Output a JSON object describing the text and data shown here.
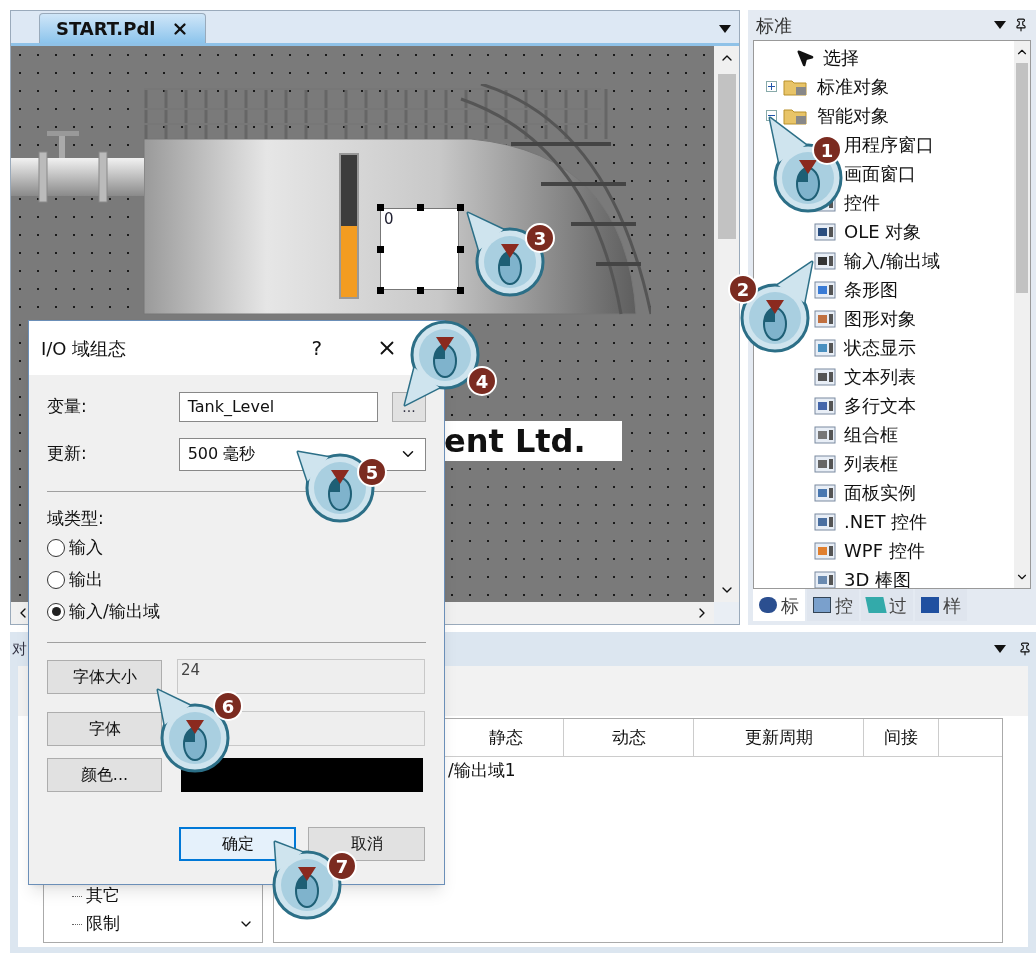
{
  "editor": {
    "tabs": [
      {
        "label": "START.Pdl",
        "selected": true
      }
    ],
    "canvas": {
      "bar_graph": {
        "level": 0.5
      },
      "io_field": {
        "value": "0"
      },
      "text_object": "ent Ltd."
    }
  },
  "toolbox": {
    "title": "标准",
    "tree": [
      {
        "label": "选择",
        "kind": "pointer"
      },
      {
        "label": "标准对象",
        "kind": "folder",
        "expanded": false
      },
      {
        "label": "智能对象",
        "kind": "folder",
        "expanded": true,
        "children": [
          {
            "label": "用程序窗口"
          },
          {
            "label": "画面窗口"
          },
          {
            "label": "控件"
          },
          {
            "label": "OLE 对象"
          },
          {
            "label": "输入/输出域"
          },
          {
            "label": "条形图"
          },
          {
            "label": "图形对象"
          },
          {
            "label": "状态显示"
          },
          {
            "label": "文本列表"
          },
          {
            "label": "多行文本"
          },
          {
            "label": "组合框"
          },
          {
            "label": "列表框"
          },
          {
            "label": "面板实例"
          },
          {
            "label": ".NET 控件"
          },
          {
            "label": "WPF 控件"
          },
          {
            "label": "3D 棒图"
          }
        ]
      }
    ],
    "tabs": [
      {
        "label": "标",
        "selected": true
      },
      {
        "label": "控",
        "selected": false
      },
      {
        "label": "过",
        "selected": false
      },
      {
        "label": "样",
        "selected": false
      }
    ]
  },
  "properties": {
    "title": "对",
    "tree": [
      {
        "label": "其它"
      },
      {
        "label": "限制"
      }
    ],
    "table": {
      "columns": [
        "静态",
        "动态",
        "更新周期",
        "间接"
      ],
      "rows": [
        {
          "column_1": "/输出域1"
        }
      ]
    }
  },
  "dialog": {
    "title": "I/O 域组态",
    "help": "?",
    "variable": {
      "label": "变量:",
      "value": "Tank_Level",
      "browse": "..."
    },
    "update": {
      "label": "更新:",
      "value": "500 毫秒"
    },
    "field_type": {
      "label": "域类型:",
      "options": [
        {
          "label": "输入",
          "selected": false
        },
        {
          "label": "输出",
          "selected": false
        },
        {
          "label": "输入/输出域",
          "selected": true
        }
      ]
    },
    "font_size": {
      "button": "字体大小",
      "value": "24"
    },
    "font": {
      "button": "字体"
    },
    "color": {
      "button": "颜色...",
      "color": "#000000"
    },
    "buttons": [
      {
        "label": "确定",
        "default": true
      },
      {
        "label": "取消",
        "default": false
      }
    ]
  },
  "callouts": [
    "1",
    "2",
    "3",
    "4",
    "5",
    "6",
    "7"
  ]
}
